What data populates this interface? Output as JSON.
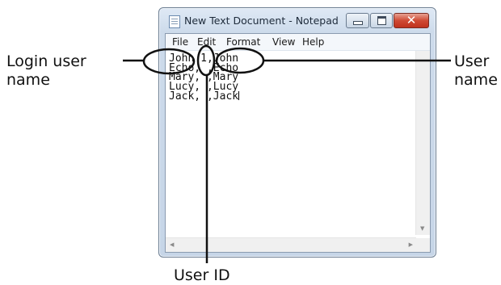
{
  "window": {
    "title": "New Text Document - Notepad",
    "menu": [
      "File",
      "Edit",
      "Format",
      "View",
      "Help"
    ]
  },
  "document": {
    "lines": [
      "John, 1, John",
      "Echo, 2, Echo",
      "Mary, , Mary",
      "Lucy, , Lucy",
      "Jack, , Jack"
    ],
    "visible_lines": [
      "John 1,John",
      "Echo, ,Echo",
      "Mary, ,Mary",
      "Lucy, ,Lucy",
      "Jack, ,Jack"
    ]
  },
  "annotations": {
    "login_user_name": [
      "Login user",
      "name"
    ],
    "user_name": [
      "User",
      "name"
    ],
    "user_id": "User ID"
  },
  "colors": {
    "annotation_stroke": "#111111",
    "close_button": "#c8412a"
  }
}
